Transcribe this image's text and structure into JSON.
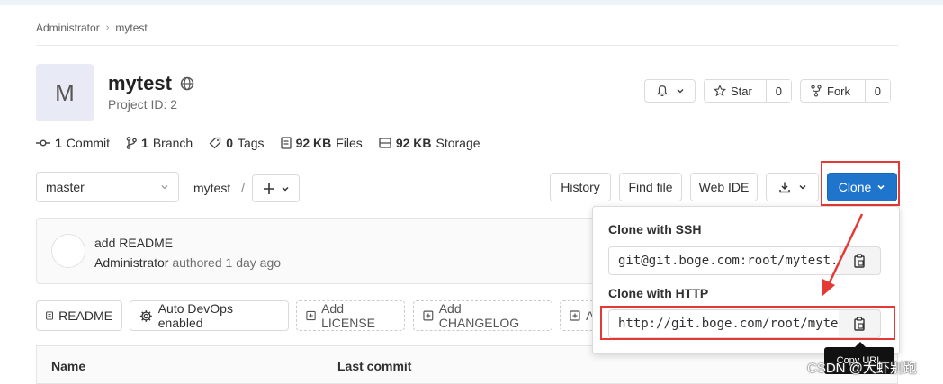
{
  "breadcrumb": {
    "owner": "Administrator",
    "project": "mytest"
  },
  "project": {
    "avatar_letter": "M",
    "name": "mytest",
    "id_text": "Project ID: 2"
  },
  "actions": {
    "star_label": "Star",
    "star_count": "0",
    "fork_label": "Fork",
    "fork_count": "0"
  },
  "stats": {
    "commits_count": "1",
    "commits_label": "Commit",
    "branches_count": "1",
    "branches_label": "Branch",
    "tags_count": "0",
    "tags_label": "Tags",
    "files_size": "92 KB",
    "files_label": "Files",
    "storage_size": "92 KB",
    "storage_label": "Storage"
  },
  "repo_toolbar": {
    "branch": "master",
    "path": "mytest",
    "path_sep": "/",
    "history": "History",
    "find_file": "Find file",
    "web_ide": "Web IDE",
    "clone": "Clone"
  },
  "commit": {
    "title": "add README",
    "author": "Administrator",
    "meta": "authored 1 day ago"
  },
  "quick_actions": {
    "readme": "README",
    "auto_devops": "Auto DevOps enabled",
    "add_license": "Add LICENSE",
    "add_changelog": "Add CHANGELOG",
    "add_partial": "A"
  },
  "table": {
    "col_name": "Name",
    "col_last_commit": "Last commit"
  },
  "clone_dropdown": {
    "ssh_label": "Clone with SSH",
    "ssh_url": "git@git.boge.com:root/mytest.git",
    "http_label": "Clone with HTTP",
    "http_url": "http://git.boge.com/root/mytest.git",
    "copy_tooltip": "Copy URL"
  },
  "watermark": "CSDN @大虾别跑",
  "colors": {
    "primary": "#1f75cb",
    "annotation_red": "#e53935"
  }
}
